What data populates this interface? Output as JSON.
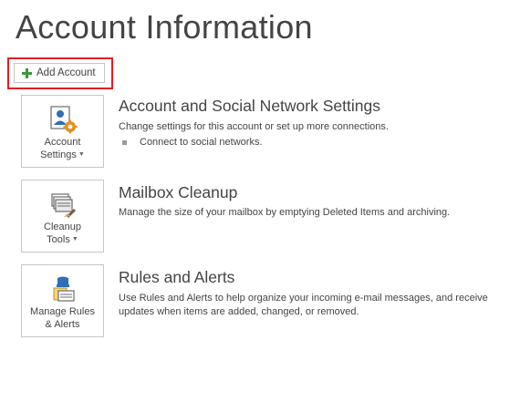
{
  "page": {
    "title": "Account Information"
  },
  "add_account": {
    "label": "Add Account"
  },
  "sections": {
    "account_settings": {
      "button_line1": "Account",
      "button_line2": "Settings",
      "title": "Account and Social Network Settings",
      "description": "Change settings for this account or set up more connections.",
      "bullet": "Connect to social networks."
    },
    "cleanup": {
      "button_line1": "Cleanup",
      "button_line2": "Tools",
      "title": "Mailbox Cleanup",
      "description": "Manage the size of your mailbox by emptying Deleted Items and archiving."
    },
    "rules": {
      "button_line1": "Manage Rules",
      "button_line2": "& Alerts",
      "title": "Rules and Alerts",
      "description_line1": "Use Rules and Alerts to help organize your incoming e-mail messages, and receive",
      "description_line2": "updates when items are added, changed, or removed."
    }
  },
  "icons": {
    "plus": "plus-icon",
    "account_settings": "account-settings-icon",
    "cleanup": "cleanup-tools-icon",
    "rules": "rules-alerts-icon",
    "dropdown": "chevron-down-icon"
  },
  "colors": {
    "highlight": "#e31e24",
    "plus_green": "#3a9b3a",
    "accent_blue": "#2f6fb5",
    "accent_orange": "#e8901a"
  }
}
